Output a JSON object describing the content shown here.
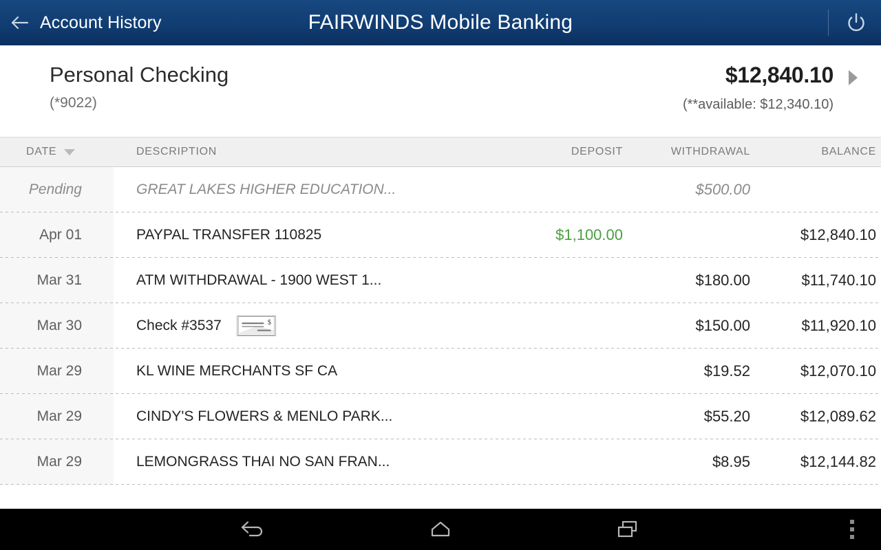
{
  "appbar": {
    "back_icon": "back-arrow-icon",
    "back_label": "Account History",
    "title": "FAIRWINDS Mobile Banking",
    "power_icon": "power-icon",
    "background_color": "#103c71"
  },
  "account": {
    "name": "Personal Checking",
    "number": "(*9022)",
    "balance": "$12,840.10",
    "available": "(**available: $12,340.10)",
    "chevron_icon": "chevron-right-icon"
  },
  "table": {
    "columns": {
      "date": "DATE",
      "description": "DESCRIPTION",
      "deposit": "DEPOSIT",
      "withdrawal": "WITHDRAWAL",
      "balance": "BALANCE"
    },
    "sort": {
      "column": "DATE",
      "direction": "descending",
      "icon": "sort-descending-caret-icon"
    },
    "rows": [
      {
        "date": "Pending",
        "description": "GREAT LAKES HIGHER EDUCATION...",
        "deposit": "",
        "withdrawal": "$500.00",
        "balance": "",
        "pending": true,
        "check_image": false
      },
      {
        "date": "Apr 01",
        "description": "PAYPAL TRANSFER 110825",
        "deposit": "$1,100.00",
        "withdrawal": "",
        "balance": "$12,840.10",
        "pending": false,
        "check_image": false
      },
      {
        "date": "Mar 31",
        "description": "ATM WITHDRAWAL - 1900 WEST 1...",
        "deposit": "",
        "withdrawal": "$180.00",
        "balance": "$11,740.10",
        "pending": false,
        "check_image": false
      },
      {
        "date": "Mar 30",
        "description": "Check #3537",
        "deposit": "",
        "withdrawal": "$150.00",
        "balance": "$11,920.10",
        "pending": false,
        "check_image": true
      },
      {
        "date": "Mar 29",
        "description": "KL WINE MERCHANTS SF CA",
        "deposit": "",
        "withdrawal": "$19.52",
        "balance": "$12,070.10",
        "pending": false,
        "check_image": false
      },
      {
        "date": "Mar 29",
        "description": "CINDY'S FLOWERS & MENLO PARK...",
        "deposit": "",
        "withdrawal": "$55.20",
        "balance": "$12,089.62",
        "pending": false,
        "check_image": false
      },
      {
        "date": "Mar 29",
        "description": "LEMONGRASS THAI NO SAN FRAN...",
        "deposit": "",
        "withdrawal": "$8.95",
        "balance": "$12,144.82",
        "pending": false,
        "check_image": false
      }
    ]
  },
  "navbar": {
    "back_icon": "android-back-icon",
    "home_icon": "android-home-icon",
    "recents_icon": "android-recents-icon",
    "overflow_icon": "overflow-menu-icon"
  },
  "colors": {
    "brand_blue": "#103c71",
    "deposit_green": "#4a9e3f",
    "date_column_bg": "#f7f7f7",
    "header_row_bg": "#f0f0f0"
  }
}
